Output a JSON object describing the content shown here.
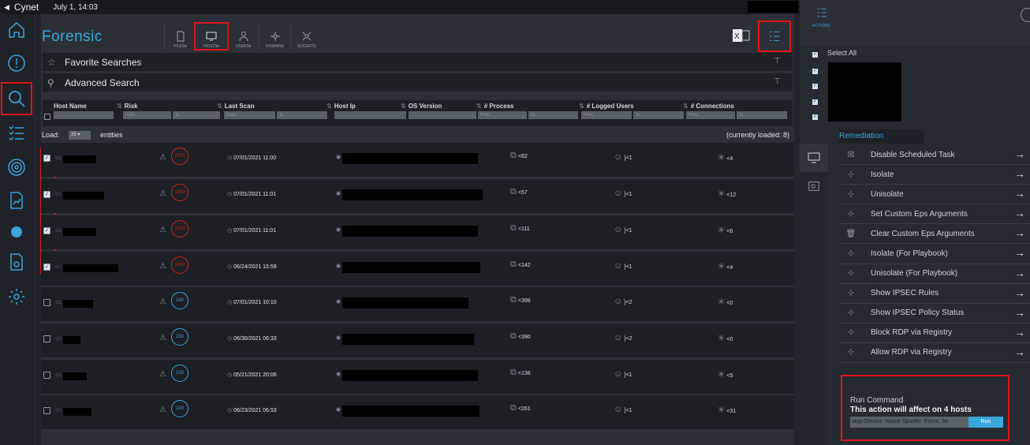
{
  "topbar": {
    "brand": "Cynet",
    "datetime": "July 1, 14:03"
  },
  "page": {
    "title": "Forensic"
  },
  "tabs": [
    {
      "label": "FILES▾"
    },
    {
      "label": "HOSTS▾"
    },
    {
      "label": "USERS▾"
    },
    {
      "label": "DOMAINS"
    },
    {
      "label": "SOCKETS"
    }
  ],
  "actions_label": "ACTIONS",
  "sections": {
    "favorite": "Favorite Searches",
    "advanced": "Advanced Search"
  },
  "columns": {
    "host_name": "Host Name",
    "risk": "Risk",
    "last_scan": "Last Scan",
    "host_ip": "Host Ip",
    "os_version": "OS Version",
    "process": "# Process",
    "logged_users": "# Logged Users",
    "connections": "# Connections"
  },
  "filters": {
    "from": "From",
    "to": "To"
  },
  "load": {
    "label": "Load:",
    "value": "25",
    "entities": "entities",
    "loaded": "(currently loaded: 8)"
  },
  "rows": [
    {
      "risk": "1000",
      "scan": "07/01/2021 11:00",
      "process": "62",
      "users": "1",
      "conns": "4"
    },
    {
      "risk": "1000",
      "scan": "07/01/2021 11:01",
      "process": "57",
      "users": "1",
      "conns": "12"
    },
    {
      "risk": "1000",
      "scan": "07/01/2021 11:01",
      "process": "111",
      "users": "1",
      "conns": "6"
    },
    {
      "risk": "1000",
      "scan": "06/24/2021 15:59",
      "process": "142",
      "users": "1",
      "conns": "4"
    },
    {
      "risk": "180",
      "scan": "07/01/2021 10:10",
      "process": "398",
      "users": "2",
      "conns": "0"
    },
    {
      "risk": "150",
      "scan": "06/30/2021 06:33",
      "process": "390",
      "users": "2",
      "conns": "0"
    },
    {
      "risk": "100",
      "scan": "05/21/2021 20:06",
      "process": "136",
      "users": "1",
      "conns": "5"
    },
    {
      "risk": "100",
      "scan": "06/23/2021 06:53",
      "process": "261",
      "users": "1",
      "conns": "31"
    }
  ],
  "right": {
    "select_all": "Select All",
    "remediation_tab": "Remediation",
    "remediation": [
      "Disable Scheduled Task",
      "Isolate",
      "Unisolate",
      "Set Custom Eps Arguments",
      "Clear Custom Eps Arguments",
      "Isolate (For Playbook)",
      "Unisolate (For Playbook)",
      "Show IPSEC Rules",
      "Show IPSEC Policy Status",
      "Block RDP via Registry",
      "Allow RDP via Registry"
    ],
    "run": {
      "title": "Run Command",
      "affect": "This action will affect on 4 hosts",
      "command": "stop-Service -Name Spooler -Force; Se",
      "button": "Run"
    }
  },
  "colors": {
    "accent": "#36a8d8",
    "danger": "#d02020",
    "highlight": "#e0141a"
  }
}
